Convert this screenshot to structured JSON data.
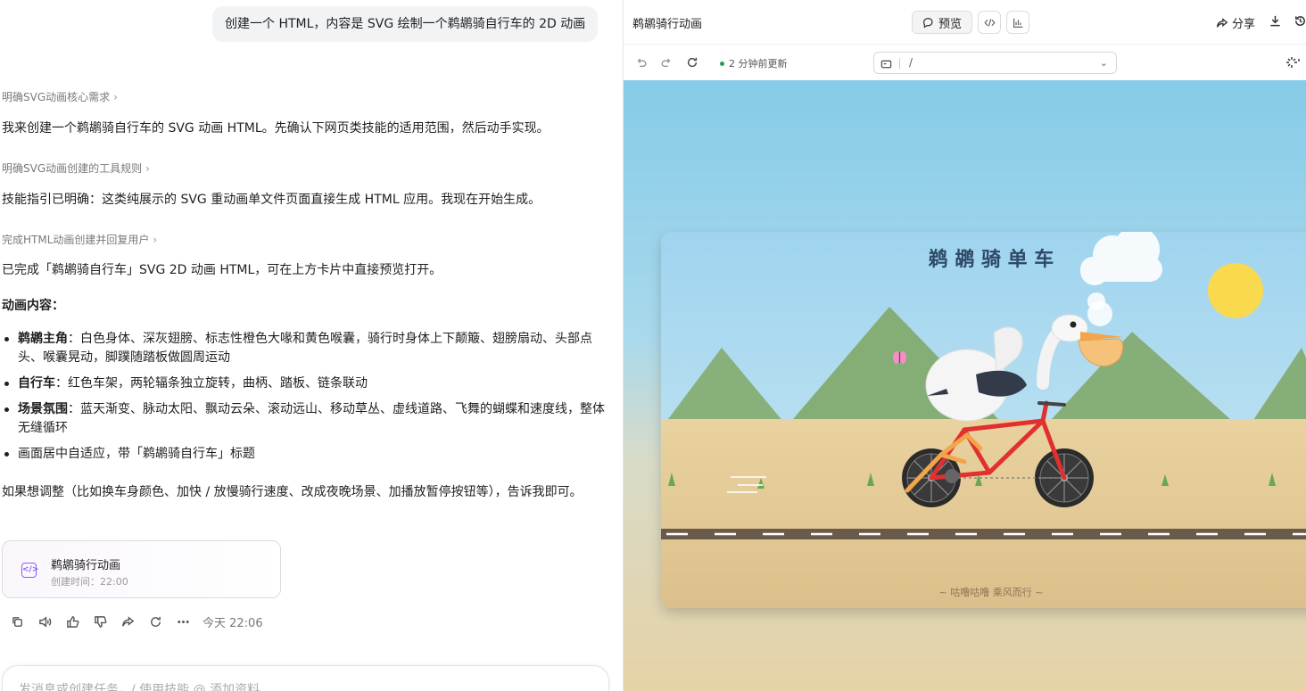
{
  "chat": {
    "user_message": "创建一个 HTML，内容是 SVG 绘制一个鹈鹕骑自行车的 2D 动画",
    "step1": "明确SVG动画核心需求",
    "para1": "我来创建一个鹈鹕骑自行车的 SVG 动画 HTML。先确认下网页类技能的适用范围，然后动手实现。",
    "step2": "明确SVG动画创建的工具规则",
    "para2": "技能指引已明确：这类纯展示的 SVG 重动画单文件页面直接生成 HTML 应用。我现在开始生成。",
    "step3": "完成HTML动画创建并回复用户",
    "para3": "已完成「鹈鹕骑自行车」SVG 2D 动画 HTML，可在上方卡片中直接预览打开。",
    "content_heading": "动画内容：",
    "bullets": [
      {
        "bold": "鹈鹕主角",
        "text": "：白色身体、深灰翅膀、标志性橙色大喙和黄色喉囊，骑行时身体上下颠簸、翅膀扇动、头部点头、喉囊晃动，脚蹼随踏板做圆周运动"
      },
      {
        "bold": "自行车",
        "text": "：红色车架，两轮辐条独立旋转，曲柄、踏板、链条联动"
      },
      {
        "bold": "场景氛围",
        "text": "：蓝天渐变、脉动太阳、飘动云朵、滚动远山、移动草丛、虚线道路、飞舞的蝴蝶和速度线，整体无缝循环"
      },
      {
        "bold": "",
        "text": "画面居中自适应，带「鹈鹕骑自行车」标题"
      }
    ],
    "para4": "如果想调整（比如换车身颜色、加快 / 放慢骑行速度、改成夜晚场景、加播放暂停按钮等），告诉我即可。",
    "card": {
      "title": "鹈鹕骑行动画",
      "subtitle": "创建时间：22:00"
    },
    "timestamp": "今天 22:06",
    "input_placeholder": "发消息或创建任务，/ 使用技能 @ 添加资料"
  },
  "preview": {
    "title": "鹈鹕骑行动画",
    "preview_label": "预览",
    "share_label": "分享",
    "status": "2 分钟前更新",
    "url": "/",
    "scene": {
      "title": "鹈 鹕 骑 单 车",
      "caption": "~ 咕噜咕噜 乘风而行 ~"
    }
  },
  "colors": {
    "accent_purple": "#8b5cf6",
    "status_green": "#22a050",
    "bike_red": "#e0302f",
    "beak_orange": "#f2a54a",
    "sun_yellow": "#f9d94e",
    "mountain_green": "#87b07a",
    "ground_sand": "#e6cc97"
  },
  "icons": {
    "actions": [
      "copy-icon",
      "speaker-icon",
      "thumbs-up-icon",
      "thumbs-down-icon",
      "share-icon",
      "refresh-icon",
      "more-icon"
    ],
    "toolbar": [
      "preview-icon",
      "code-icon",
      "chart-icon",
      "share-icon",
      "download-icon",
      "history-icon"
    ],
    "nav": [
      "undo-icon",
      "redo-icon",
      "reload-icon",
      "page-icon",
      "chevron-down-icon",
      "sparkle-icon"
    ]
  }
}
